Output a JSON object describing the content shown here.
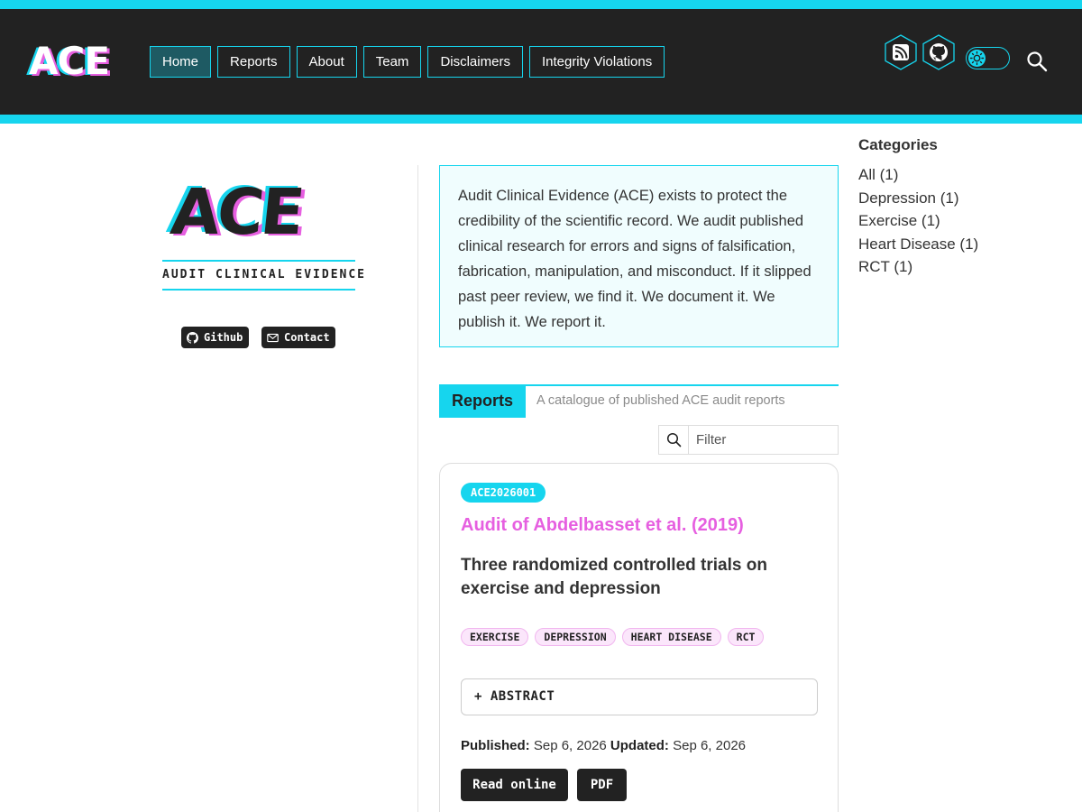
{
  "header": {
    "logo_text": "ACE",
    "nav": [
      {
        "label": "Home",
        "active": true
      },
      {
        "label": "Reports",
        "active": false
      },
      {
        "label": "About",
        "active": false
      },
      {
        "label": "Team",
        "active": false
      },
      {
        "label": "Disclaimers",
        "active": false
      },
      {
        "label": "Integrity Violations",
        "active": false
      }
    ],
    "icons": [
      "rss-icon",
      "github-icon",
      "theme-toggle",
      "search-icon"
    ]
  },
  "sidebar_left": {
    "logo_text": "ACE",
    "tagline": "AUDIT CLINICAL EVIDENCE",
    "github_label": "Github",
    "contact_label": "Contact"
  },
  "intro": {
    "text": "Audit Clinical Evidence (ACE) exists to protect the credibility of the scientific record. We audit published clinical research for errors and signs of falsification, fabrication, manipulation, and misconduct. If it slipped past peer review, we find it. We document it. We publish it. We report it."
  },
  "reports": {
    "heading": "Reports",
    "subtitle": "A catalogue of published ACE audit reports",
    "filter_placeholder": "Filter",
    "items": [
      {
        "id": "ACE2026001",
        "title": "Audit of Abdelbasset et al. (2019)",
        "subtitle": "Three randomized controlled trials on exercise and depression",
        "tags": [
          "EXERCISE",
          "DEPRESSION",
          "HEART DISEASE",
          "RCT"
        ],
        "abstract_label": "+ ABSTRACT",
        "published_label": "Published:",
        "published": "Sep 6, 2026",
        "updated_label": "Updated:",
        "updated": "Sep 6, 2026",
        "read_label": "Read online",
        "pdf_label": "PDF"
      }
    ]
  },
  "categories": {
    "title": "Categories",
    "items": [
      "All (1)",
      "Depression (1)",
      "Exercise (1)",
      "Heart Disease (1)",
      "RCT (1)"
    ]
  },
  "colors": {
    "accent_cyan": "#16d5ee",
    "accent_magenta": "#e65fe0",
    "header_bg": "#222222"
  }
}
